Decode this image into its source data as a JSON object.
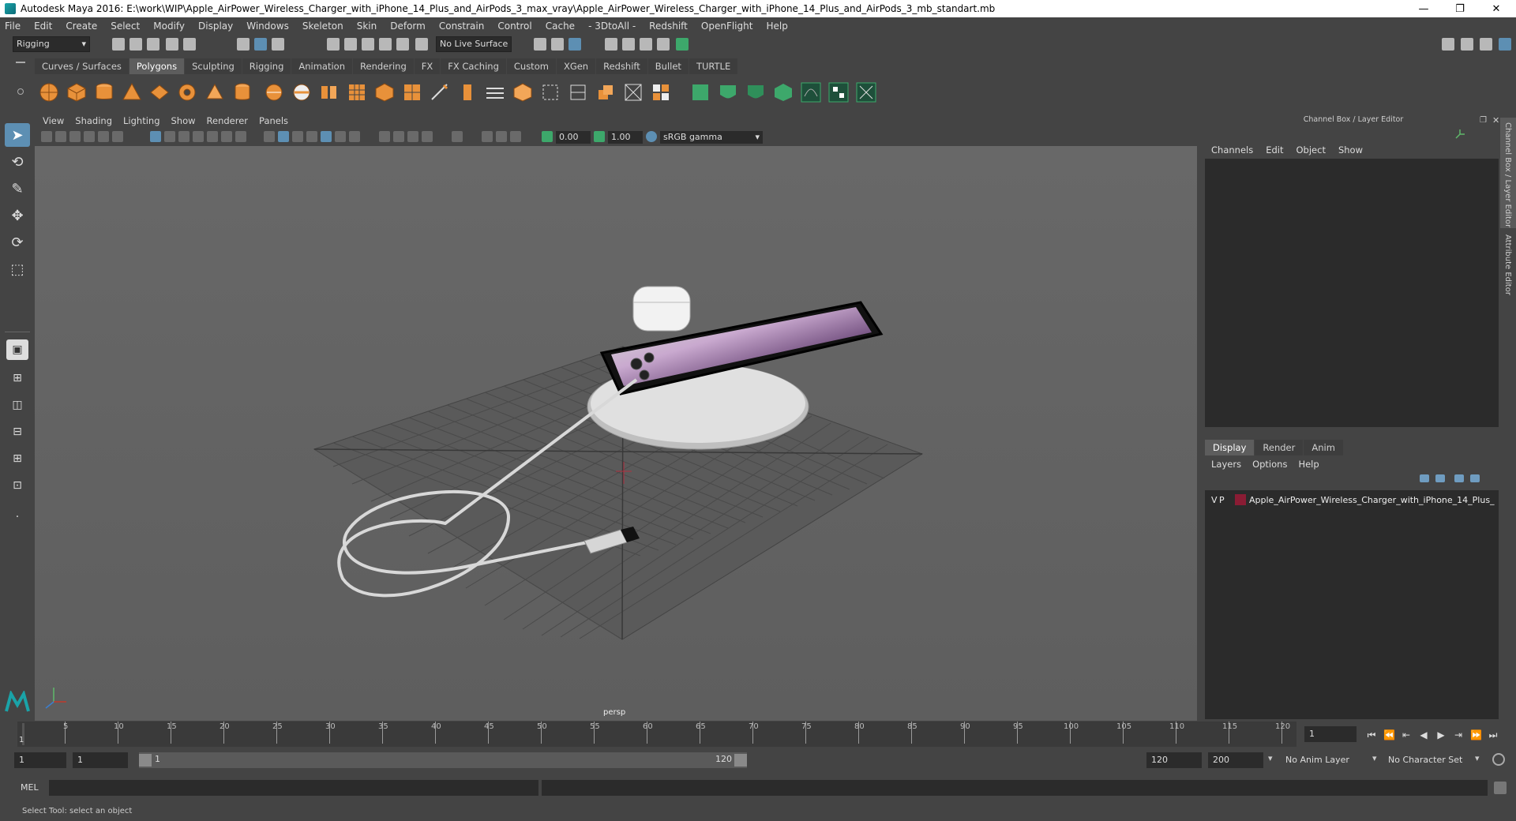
{
  "window": {
    "title": "Autodesk Maya 2016: E:\\work\\WIP\\Apple_AirPower_Wireless_Charger_with_iPhone_14_Plus_and_AirPods_3_max_vray\\Apple_AirPower_Wireless_Charger_with_iPhone_14_Plus_and_AirPods_3_mb_standart.mb",
    "minimize": "—",
    "restore": "❐",
    "close": "✕"
  },
  "menu": [
    "File",
    "Edit",
    "Create",
    "Select",
    "Modify",
    "Display",
    "Windows",
    "Skeleton",
    "Skin",
    "Deform",
    "Constrain",
    "Control",
    "Cache",
    "- 3DtoAll -",
    "Redshift",
    "OpenFlight",
    "Help"
  ],
  "status": {
    "mode": "Rigging",
    "live_surface": "No Live Surface"
  },
  "shelf": {
    "tabs": [
      "Curves / Surfaces",
      "Polygons",
      "Sculpting",
      "Rigging",
      "Animation",
      "Rendering",
      "FX",
      "FX Caching",
      "Custom",
      "XGen",
      "Redshift",
      "Bullet",
      "TURTLE"
    ],
    "active": "Polygons"
  },
  "viewport": {
    "menu": [
      "View",
      "Shading",
      "Lighting",
      "Show",
      "Renderer",
      "Panels"
    ],
    "exposure": "0.00",
    "gamma": "1.00",
    "colorspace": "sRGB gamma",
    "camera": "persp"
  },
  "channelbox": {
    "header": "Channel Box / Layer Editor",
    "menu": [
      "Channels",
      "Edit",
      "Object",
      "Show"
    ]
  },
  "layereditor": {
    "tabs": [
      "Display",
      "Render",
      "Anim"
    ],
    "menu": [
      "Layers",
      "Options",
      "Help"
    ],
    "layer_v": "V",
    "layer_p": "P",
    "layer_name": "Apple_AirPower_Wireless_Charger_with_iPhone_14_Plus_",
    "layer_color": "#8a1c34"
  },
  "side_tabs": {
    "channel_box": "Channel Box / Layer Editor",
    "attribute_editor": "Attribute Editor"
  },
  "timeline": {
    "ticks": [
      "5",
      "10",
      "15",
      "20",
      "25",
      "30",
      "35",
      "40",
      "45",
      "50",
      "55",
      "60",
      "65",
      "70",
      "75",
      "80",
      "85",
      "90",
      "95",
      "100",
      "105",
      "110",
      "115",
      "120"
    ],
    "current_frame": "1",
    "start_marker": "1"
  },
  "range": {
    "start": "1",
    "start_playback": "1",
    "slider_start": "1",
    "slider_end": "120",
    "end_playback": "120",
    "end": "200",
    "anim_layer": "No Anim Layer",
    "character_set": "No Character Set"
  },
  "command": {
    "label": "MEL"
  },
  "help_line": "Select Tool: select an object",
  "colors": {
    "accent": "#5d8fb3",
    "background": "#444444",
    "field": "#2b2b2b",
    "viewport": "#646464"
  }
}
